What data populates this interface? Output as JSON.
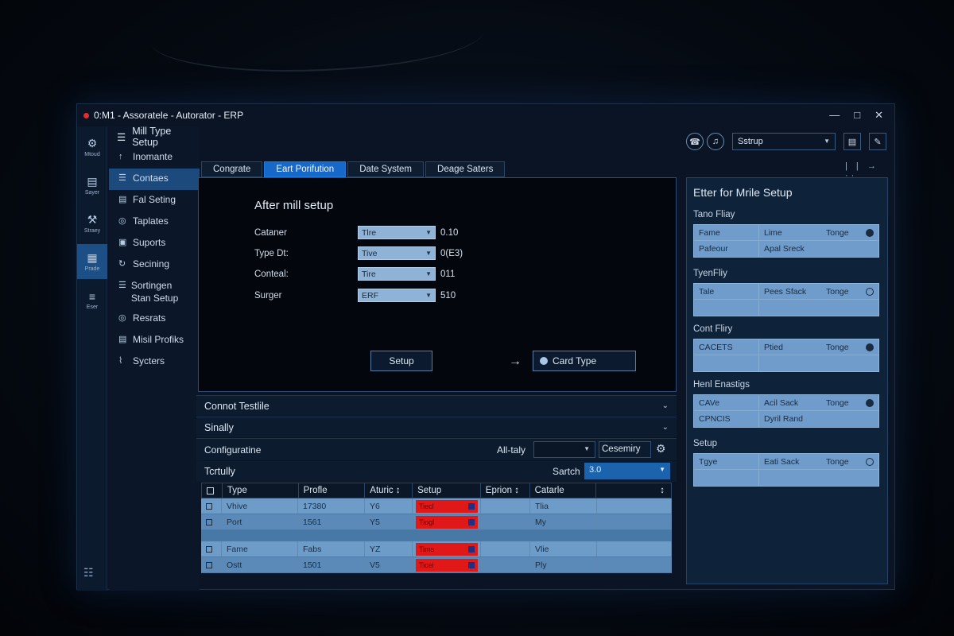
{
  "window": {
    "title": "0:M1 - Assoratele - Autorator - ERP",
    "controls": [
      "—",
      "□",
      "✕"
    ]
  },
  "rail": {
    "items": [
      {
        "icon": "⚙",
        "label": "Mtoud"
      },
      {
        "icon": "▤",
        "label": "Sayer"
      },
      {
        "icon": "⚒",
        "label": "Straey"
      },
      {
        "icon": "▦",
        "label": "Prade"
      },
      {
        "icon": "≡",
        "label": "Eser"
      }
    ],
    "grid_icon": "☷"
  },
  "nav": {
    "header": "Mill Type Setup",
    "items": [
      {
        "icon": "↑",
        "label": "Inomante"
      },
      {
        "icon": "☰",
        "label": "Contaes"
      },
      {
        "icon": "▤",
        "label": "Fal Seting"
      },
      {
        "icon": "◎",
        "label": "Taplates"
      },
      {
        "icon": "▣",
        "label": "Suports"
      },
      {
        "icon": "↻",
        "label": "Secining"
      },
      {
        "icon": "☰",
        "label": "Sortingen Stan Setup"
      },
      {
        "icon": "◎",
        "label": "Resrats"
      },
      {
        "icon": "▤",
        "label": "Misil Profiks"
      },
      {
        "icon": "⌇",
        "label": "Sycters"
      }
    ]
  },
  "tabs": [
    "Congrate",
    "Eart Porifution",
    "Date System",
    "Deage Saters"
  ],
  "form": {
    "title": "After mill setup",
    "rows": [
      {
        "label": "Cataner",
        "select": "Tlre",
        "value": "0.10"
      },
      {
        "label": "Type Dt:",
        "select": "Tive",
        "value": "0(E3)"
      },
      {
        "label": "Conteal:",
        "select": "Tire",
        "value": "011"
      },
      {
        "label": "Surger",
        "select": "ERF",
        "value": "510"
      }
    ],
    "setup_button": "Setup",
    "card_type_button": "Card Type",
    "arrow": "→"
  },
  "accordions": [
    {
      "label": "Connot Testlile",
      "chev": "⌄"
    },
    {
      "label": "Sinally",
      "chev": "⌄"
    }
  ],
  "config": {
    "label": "Configuratine",
    "all_label": "All-taly",
    "dropdown_value": "",
    "cemsmiry": "Cesemiry",
    "gear": "⚙"
  },
  "totally": {
    "label": "Tcrtully",
    "search_label": "Sartch",
    "search_value": "3.0"
  },
  "table": {
    "columns": [
      "",
      "Type",
      "Profle",
      "Aturic ↕",
      "Setup",
      "Eprion ↕",
      "Catarle",
      "↕"
    ],
    "rows": [
      {
        "type": "Vhive",
        "profile": "17380",
        "aturic": "Y6",
        "setup": "Tiecl",
        "eprion": "",
        "catarle": "Tlia"
      },
      {
        "type": "Port",
        "profile": "1561",
        "aturic": "Y5",
        "setup": "Tiogl",
        "eprion": "",
        "catarle": "My"
      },
      {
        "type": "Fame",
        "profile": "Fabs",
        "aturic": "YZ",
        "setup": "Tims",
        "eprion": "",
        "catarle": "Vlie"
      },
      {
        "type": "Ostt",
        "profile": "1501",
        "aturic": "V5",
        "setup": "Ticei",
        "eprion": "",
        "catarle": "Ply"
      }
    ],
    "accent_red": "#e01818"
  },
  "toolbar": {
    "select_value": "Sstrup",
    "mini_controls": "| | → ··"
  },
  "right_panel": {
    "title": "Etter for Mrile Setup",
    "sections": [
      {
        "title": "Tano Fliay",
        "rows": [
          {
            "c1": "Fame",
            "c2": "Lime",
            "c3": "Tonge",
            "on": true
          },
          {
            "c1": "Pafeour",
            "c2": "Apal Sreck",
            "c3": "",
            "on": null
          }
        ]
      },
      {
        "title": "TyenFliy",
        "rows": [
          {
            "c1": "Tale",
            "c2": "Pees Sfack",
            "c3": "Tonge",
            "on": false
          },
          {
            "c1": "",
            "c2": "",
            "c3": "",
            "on": null
          }
        ]
      },
      {
        "title": "Cont Fliry",
        "rows": [
          {
            "c1": "CACETS",
            "c2": "Ptied",
            "c3": "Tonge",
            "on": true
          },
          {
            "c1": "",
            "c2": "",
            "c3": "",
            "on": null
          }
        ]
      },
      {
        "title": "Henl Enastigs",
        "rows": [
          {
            "c1": "CAVe",
            "c2": "Acil Sack",
            "c3": "Tonge",
            "on": true
          },
          {
            "c1": "CPNCIS",
            "c2": "Dyril Rand",
            "c3": "",
            "on": null
          }
        ]
      },
      {
        "title": "Setup",
        "rows": [
          {
            "c1": "Tgye",
            "c2": "Eati Sack",
            "c3": "Tonge",
            "on": false
          },
          {
            "c1": "",
            "c2": "",
            "c3": "",
            "on": null
          }
        ]
      }
    ]
  }
}
